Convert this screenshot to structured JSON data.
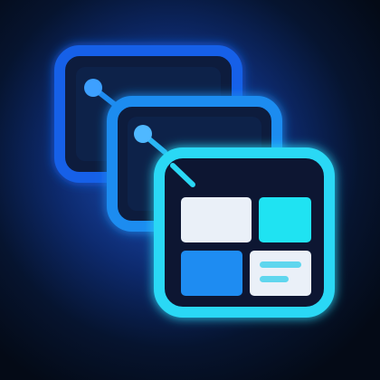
{
  "icon": {
    "name": "stacked-layout-windows-icon",
    "colors": {
      "background": "#050a16",
      "glow": "#1d54c4",
      "back_frame": "#1560e8",
      "middle_frame": "#1f8cf0",
      "front_frame": "#2ad8f5",
      "tile_white": "#eaf0f8",
      "tile_cyan": "#1fe3f2",
      "tile_blue": "#1e8cf2",
      "text_lines": "#5fd6ee"
    }
  }
}
